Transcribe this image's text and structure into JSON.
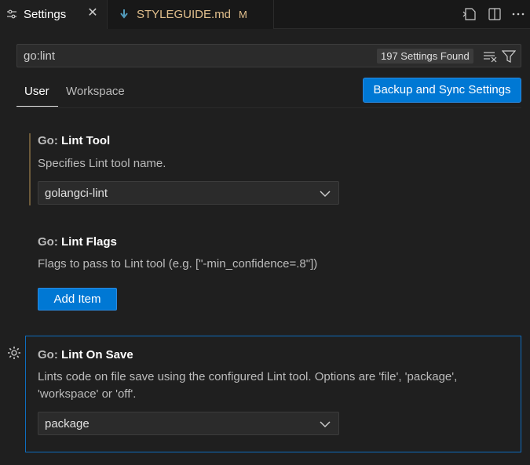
{
  "tabs": [
    {
      "title": "Settings",
      "icon": "settings-icon",
      "active": true
    },
    {
      "title": "STYLEGUIDE.md",
      "icon": "markdown-file-icon",
      "badge": "M",
      "active": false
    }
  ],
  "editor_actions": [
    "open-settings-json-icon",
    "split-editor-icon",
    "more-actions-icon"
  ],
  "search": {
    "value": "go:lint",
    "results_label": "197 Settings Found"
  },
  "scope_tabs": {
    "user": "User",
    "workspace": "Workspace"
  },
  "sync_button": "Backup and Sync Settings",
  "settings": [
    {
      "category": "Go:",
      "name": "Lint Tool",
      "description": "Specifies Lint tool name.",
      "value": "golangci-lint"
    },
    {
      "category": "Go:",
      "name": "Lint Flags",
      "description": "Flags to pass to Lint tool (e.g. [\"-min_confidence=.8\"])",
      "button": "Add Item"
    },
    {
      "category": "Go:",
      "name": "Lint On Save",
      "description_line1": "Lints code on file save using the configured Lint tool. Options are 'file', 'package',",
      "description_line2": "'workspace' or 'off'.",
      "value": "package"
    }
  ],
  "colors": {
    "accent": "#0078d4",
    "modified_tab": "#e2c08d",
    "focus_border": "#0e6dbe"
  }
}
